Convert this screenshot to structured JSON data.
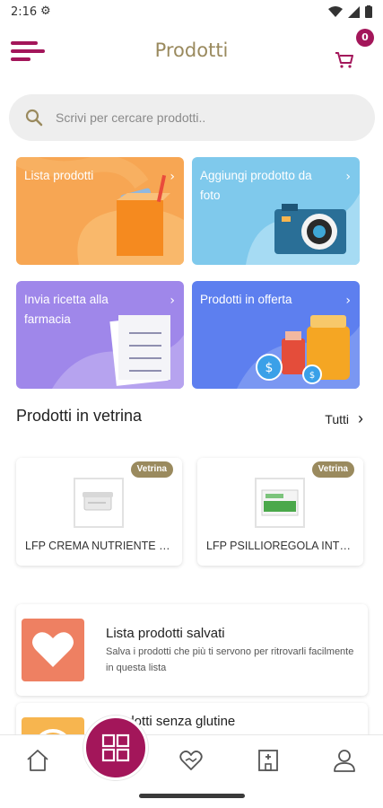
{
  "status_bar": {
    "time": "2:16"
  },
  "header": {
    "title": "Prodotti",
    "cart_count": "0"
  },
  "search": {
    "placeholder": "Scrivi per cercare prodotti.."
  },
  "tiles": [
    {
      "label": "Lista prodotti",
      "color": "#f7a653"
    },
    {
      "label": "Aggiungi prodotto da foto",
      "color": "#7fc9ec"
    },
    {
      "label": "Invia ricetta alla farmacia",
      "color": "#9f87ea"
    },
    {
      "label": "Prodotti in offerta",
      "color": "#5d7fef"
    }
  ],
  "vetrina": {
    "title": "Prodotti in vetrina",
    "all_label": "Tutti",
    "products": [
      {
        "badge": "Vetrina",
        "name": "LFP CREMA NUTRIENTE SUPER RICCA"
      },
      {
        "badge": "Vetrina",
        "name": "LFP PSILLIOREGOLA INTEGRATORE"
      }
    ]
  },
  "lists": [
    {
      "title": "Lista prodotti salvati",
      "description": "Salva i prodotti che più ti servono per ritrovarli facilmente in questa lista",
      "color": "#ee8062"
    },
    {
      "title": "Prodotti senza glutine",
      "description": "",
      "color": "#f7b54f"
    }
  ],
  "nav": {
    "items": [
      "home-icon",
      "heart-hand-icon",
      "pharmacy-icon",
      "user-icon"
    ],
    "center": "grid-icon"
  },
  "colors": {
    "accent": "#a3165a",
    "gold": "#9a8a5e"
  }
}
